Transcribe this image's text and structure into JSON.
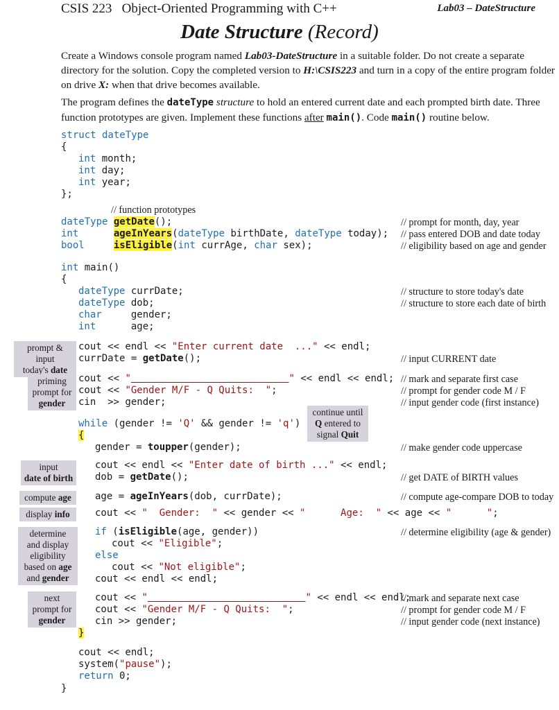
{
  "header": {
    "course": "CSIS 223   Object-Oriented Programming with C++",
    "lab": "Lab03 – DateStructure"
  },
  "title": {
    "bold_part": "Date Structure",
    "regular_part": " (Record)"
  },
  "paragraph1": {
    "t1": "Create a Windows console program named ",
    "project": "Lab03-DateStructure",
    "t2": " in a suitable folder.  Do not create a separate directory for the solution.  Copy the completed version to ",
    "path": "H:\\CSIS223",
    "t3": " and turn in a copy of the entire program folder on drive ",
    "drive": "X:",
    "t4": " when that drive becomes available."
  },
  "paragraph2": {
    "t1": "The program defines the ",
    "type": "dateType",
    "t2": " ",
    "structure": "structure",
    "t3": " to hold an entered current date and each prompted birth date. Three function prototypes are given.  Implement these functions ",
    "after": "after",
    "t4": " ",
    "main1": "main()",
    "t5": ".  Code ",
    "main2": "main()",
    "t6": " routine below."
  },
  "code": {
    "struct_kw": "struct",
    "struct_name": " dateType",
    "open": "{",
    "close": "};",
    "fields": [
      {
        "type": "int",
        "name": " month;"
      },
      {
        "type": "int",
        "name": " day;"
      },
      {
        "type": "int",
        "name": " year;"
      }
    ],
    "proto_comment": "// function prototypes",
    "prototypes": [
      {
        "ret": "dateType",
        "fn": "getDate",
        "rest_plain": "();",
        "comment": "// prompt for month, day, year"
      },
      {
        "ret": "int",
        "fn": "ageInYears",
        "comment": "// pass entered DOB and date today"
      },
      {
        "ret": "bool",
        "fn": "isEligible",
        "comment": "// eligibility based on age and gender"
      }
    ],
    "main_sig_kw": "int",
    "main_sig": " main()",
    "main_open": "{",
    "decls": [
      {
        "type": "dateType",
        "name": " currDate;",
        "comment": "// structure to store today's date"
      },
      {
        "type": "dateType",
        "name": " dob;",
        "comment": "// structure to store each date of birth"
      },
      {
        "type": "char",
        "name": "     gender;"
      },
      {
        "type": "int",
        "name": "      age;"
      }
    ],
    "comments": {
      "input_current": "// input CURRENT date",
      "mark_first": "// mark and separate first case",
      "prompt_gender": "// prompt for gender code M / F",
      "input_first": "// input gender code (first instance)",
      "uppercase": "// make gender code uppercase",
      "get_dob": "// get DATE of BIRTH values",
      "compute_age": "// compute age-compare DOB to today",
      "determine": "// determine eligibility (age & gender)",
      "mark_next": "// mark and separate next case",
      "prompt_gender2": "// prompt for gender code M / F",
      "input_next": "// input gender code (next instance)"
    },
    "return_kw": "return",
    "return_val": " 0;",
    "main_close": "}"
  },
  "tags": {
    "prompt_input": [
      "prompt & input",
      "today's ",
      "date"
    ],
    "priming": [
      "priming",
      "prompt for",
      "gender"
    ],
    "continue": [
      "continue until",
      "Q",
      " entered to",
      "signal ",
      "Quit"
    ],
    "input_dob": [
      "input",
      "date of birth"
    ],
    "compute_age": [
      "compute ",
      "age"
    ],
    "display_info": [
      "display ",
      "info"
    ],
    "determine": [
      "determine",
      "and display",
      "eligibility",
      "based on ",
      "age",
      "and ",
      "gender"
    ],
    "next": [
      "next",
      "prompt for",
      "gender"
    ]
  }
}
